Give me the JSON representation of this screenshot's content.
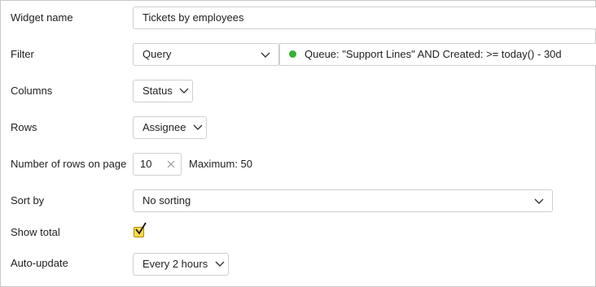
{
  "form": {
    "widget_name": {
      "label": "Widget name",
      "value": "Tickets by employees"
    },
    "filter": {
      "label": "Filter",
      "type_value": "Query",
      "query_value": "Queue: \"Support Lines\" AND Created: >= today() - 30d",
      "status_color": "#33b233"
    },
    "columns": {
      "label": "Columns",
      "value": "Status"
    },
    "rows": {
      "label": "Rows",
      "value": "Assignee"
    },
    "rows_per_page": {
      "label": "Number of rows on page",
      "value": "10",
      "maximum_text": "Maximum: 50"
    },
    "sort_by": {
      "label": "Sort by",
      "value": "No sorting"
    },
    "show_total": {
      "label": "Show total",
      "checked": true
    },
    "auto_update": {
      "label": "Auto-update",
      "value": "Every 2 hours"
    }
  },
  "colors": {
    "checkbox_fill": "#ffdb4d",
    "border": "#cfcfcf",
    "text": "#222222"
  },
  "icons": [
    "chevron-down-icon",
    "clear-icon",
    "checkmark-icon",
    "status-dot-icon"
  ]
}
